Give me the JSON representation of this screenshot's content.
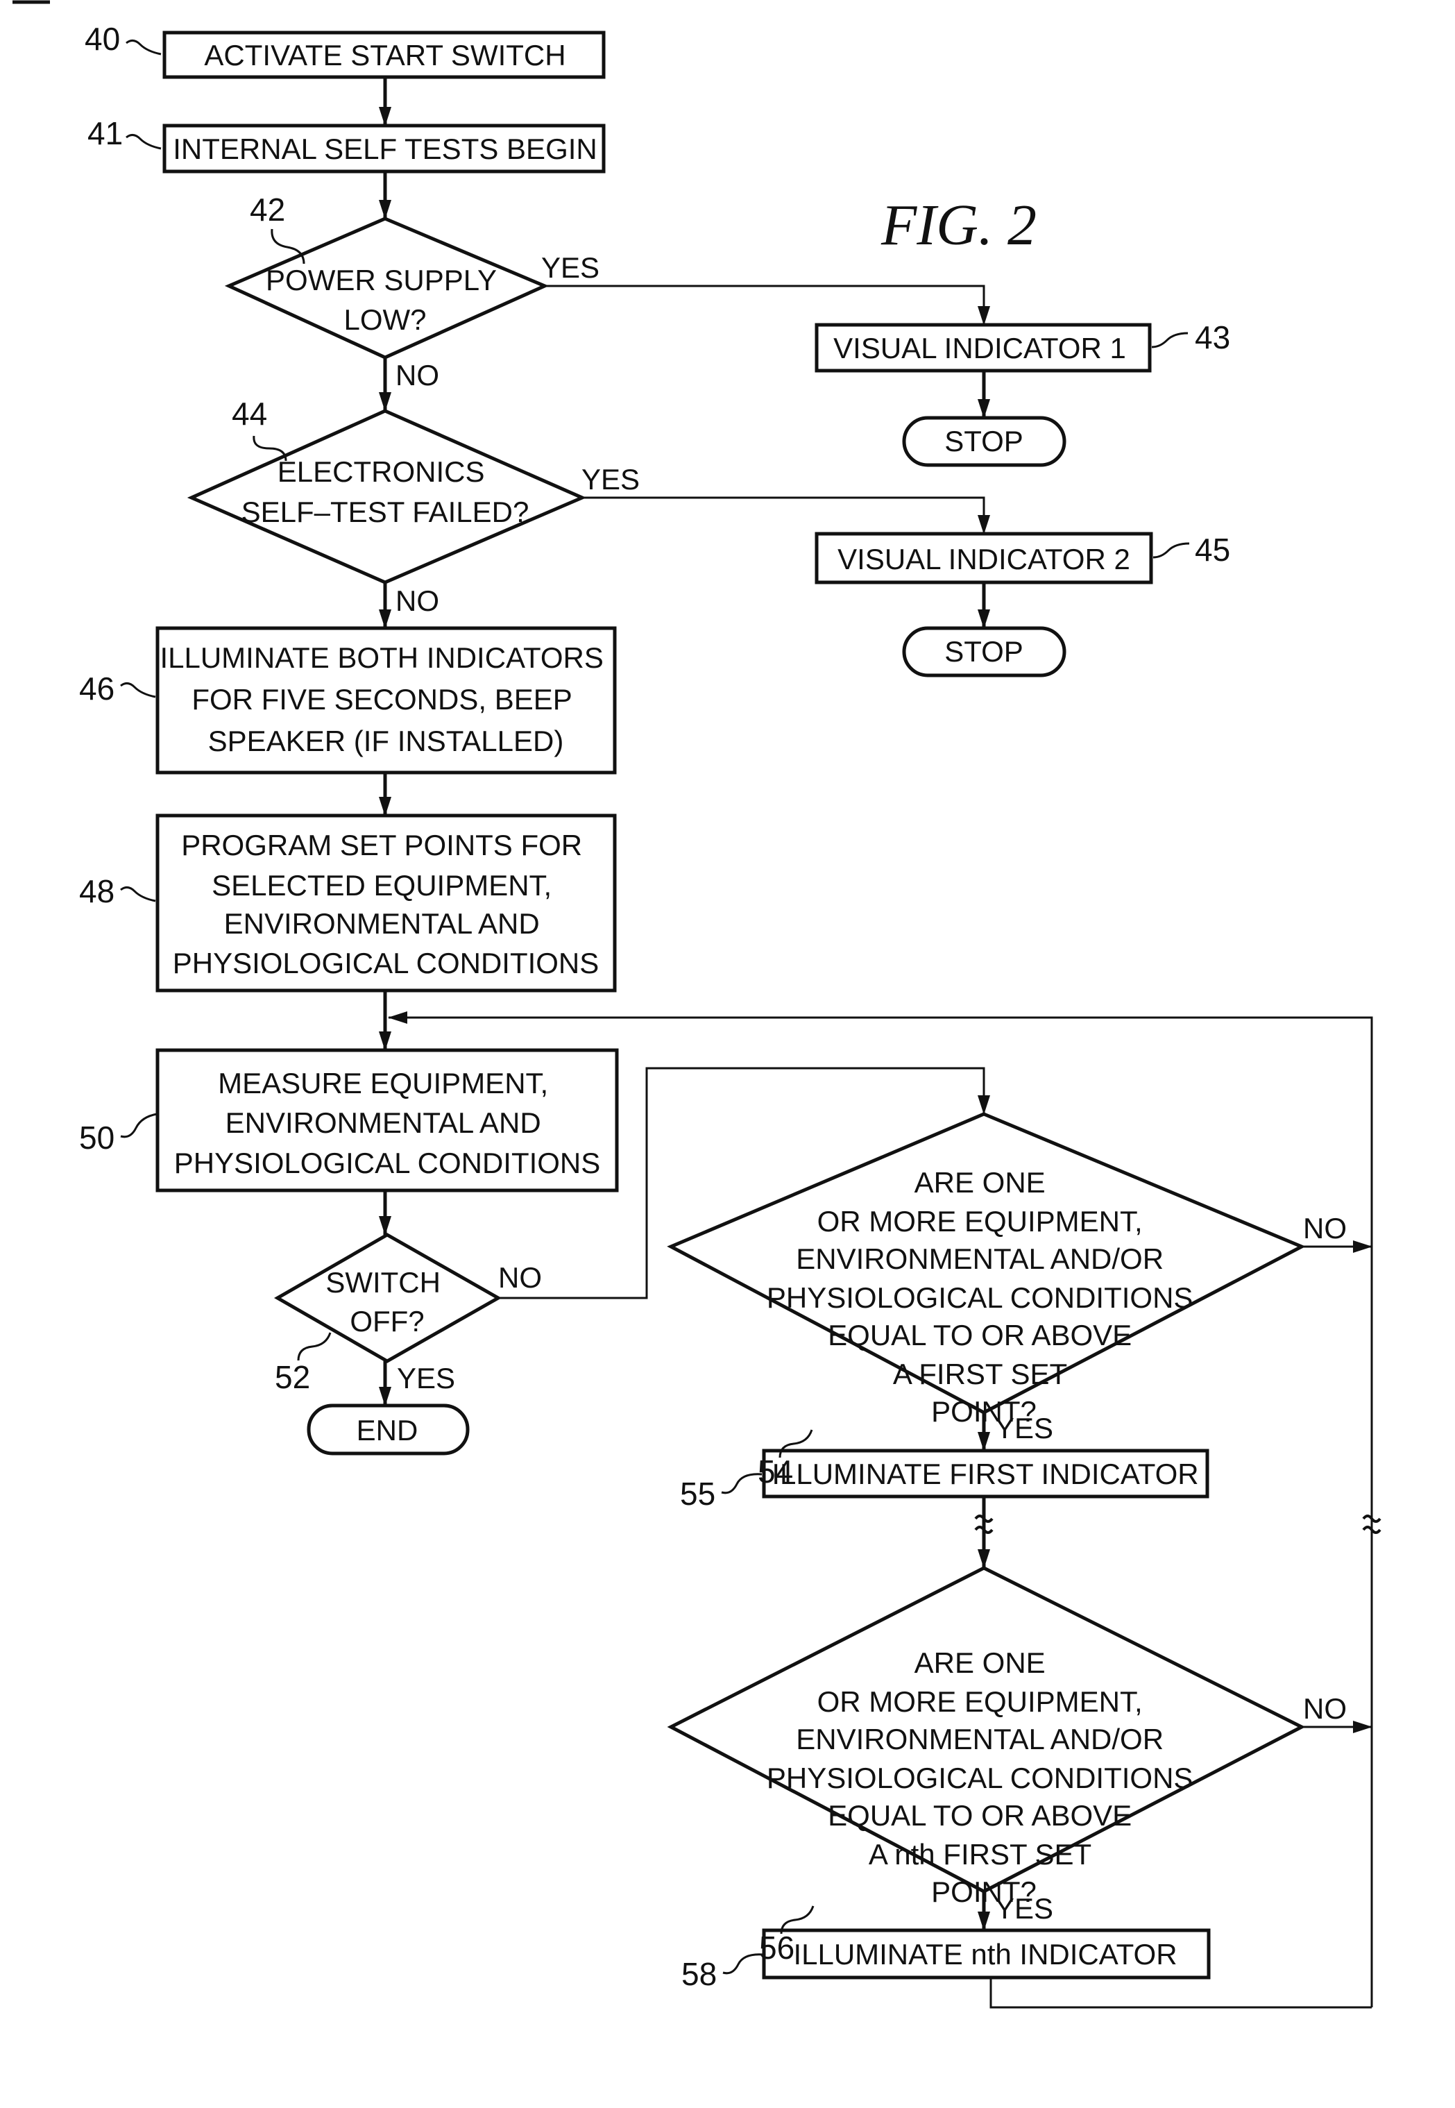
{
  "figure": {
    "title": "FIG. 2"
  },
  "nodes": {
    "n40": {
      "ref": "40",
      "type": "process",
      "lines": [
        "ACTIVATE START SWITCH"
      ]
    },
    "n41": {
      "ref": "41",
      "type": "process",
      "lines": [
        "INTERNAL SELF TESTS BEGIN"
      ]
    },
    "n42": {
      "ref": "42",
      "type": "decision",
      "lines": [
        "POWER SUPPLY",
        "LOW?"
      ]
    },
    "n43": {
      "ref": "43",
      "type": "process",
      "lines": [
        "VISUAL INDICATOR 1"
      ]
    },
    "stop1": {
      "type": "terminal",
      "lines": [
        "STOP"
      ]
    },
    "n44": {
      "ref": "44",
      "type": "decision",
      "lines": [
        "ELECTRONICS",
        "SELF–TEST FAILED?"
      ]
    },
    "n45": {
      "ref": "45",
      "type": "process",
      "lines": [
        "VISUAL INDICATOR 2"
      ]
    },
    "stop2": {
      "type": "terminal",
      "lines": [
        "STOP"
      ]
    },
    "n46": {
      "ref": "46",
      "type": "process",
      "lines": [
        "ILLUMINATE BOTH INDICATORS",
        "FOR FIVE SECONDS, BEEP",
        "SPEAKER (IF INSTALLED)"
      ]
    },
    "n48": {
      "ref": "48",
      "type": "process",
      "lines": [
        "PROGRAM SET POINTS FOR",
        "SELECTED EQUIPMENT,",
        "ENVIRONMENTAL AND",
        "PHYSIOLOGICAL CONDITIONS"
      ]
    },
    "n50": {
      "ref": "50",
      "type": "process",
      "lines": [
        "MEASURE EQUIPMENT,",
        "ENVIRONMENTAL AND",
        "PHYSIOLOGICAL CONDITIONS"
      ]
    },
    "n52": {
      "ref": "52",
      "type": "decision",
      "lines": [
        "SWITCH",
        "OFF?"
      ]
    },
    "end": {
      "type": "terminal",
      "lines": [
        "END"
      ]
    },
    "n54": {
      "ref": "54",
      "type": "decision",
      "lines": [
        "ARE ONE",
        "OR MORE EQUIPMENT,",
        "ENVIRONMENTAL AND/OR",
        "PHYSIOLOGICAL CONDITIONS",
        "EQUAL TO OR ABOVE",
        "A FIRST SET",
        "POINT?"
      ]
    },
    "n55": {
      "ref": "55",
      "type": "process",
      "lines": [
        "ILLUMINATE FIRST INDICATOR"
      ]
    },
    "n56": {
      "ref": "56",
      "type": "decision",
      "lines": [
        "ARE ONE",
        "OR MORE EQUIPMENT,",
        "ENVIRONMENTAL AND/OR",
        "PHYSIOLOGICAL CONDITIONS",
        "EQUAL TO OR ABOVE",
        "A nth FIRST SET",
        "POINT?"
      ]
    },
    "n58": {
      "ref": "58",
      "type": "process",
      "lines": [
        "ILLUMINATE nth INDICATOR"
      ]
    }
  },
  "edge_labels": {
    "n42_yes": "YES",
    "n42_no": "NO",
    "n44_yes": "YES",
    "n44_no": "NO",
    "n52_no": "NO",
    "n52_yes": "YES",
    "n54_no": "NO",
    "n54_yes": "YES",
    "n56_no": "NO",
    "n56_yes": "YES"
  }
}
